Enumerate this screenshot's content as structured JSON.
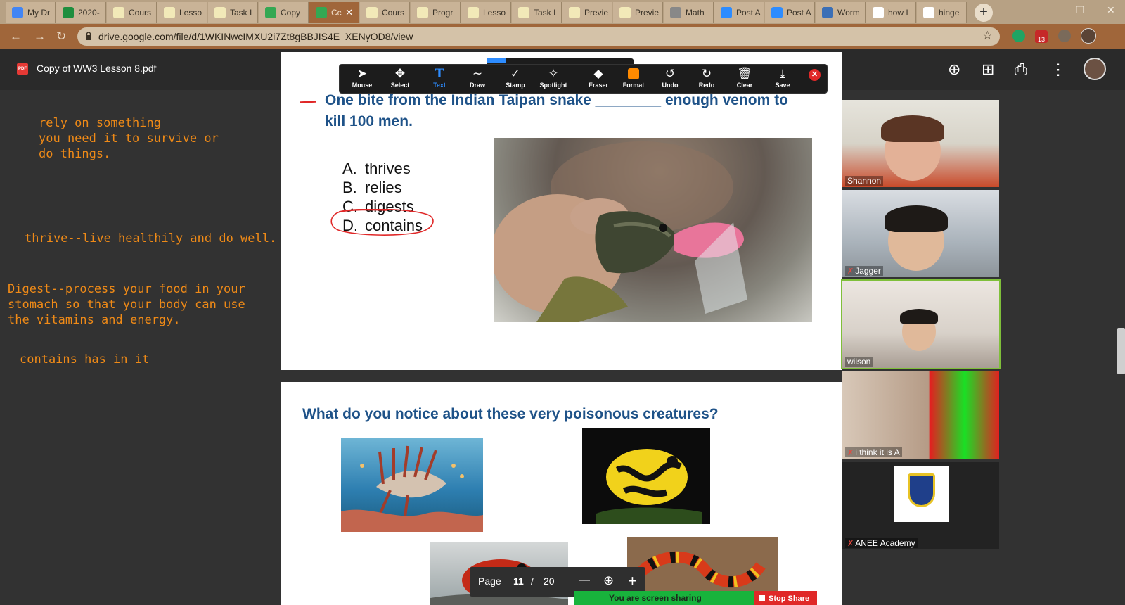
{
  "browser": {
    "tabs": [
      {
        "title": "My Dr",
        "fav": "#4285f4"
      },
      {
        "title": "2020-",
        "fav": "#1e8e3e"
      },
      {
        "title": "Cours",
        "fav": "#f2e9b8"
      },
      {
        "title": "Lesso",
        "fav": "#f2e9b8"
      },
      {
        "title": "Task I",
        "fav": "#f2e9b8"
      },
      {
        "title": "Copy",
        "fav": "#34a853"
      },
      {
        "title": "Cc",
        "fav": "#34a853",
        "active": true
      },
      {
        "title": "Cours",
        "fav": "#f2e9b8"
      },
      {
        "title": "Progr",
        "fav": "#f2e9b8"
      },
      {
        "title": "Lesso",
        "fav": "#f2e9b8"
      },
      {
        "title": "Task I",
        "fav": "#f2e9b8"
      },
      {
        "title": "Previe",
        "fav": "#f2e9b8"
      },
      {
        "title": "Previe",
        "fav": "#f2e9b8"
      },
      {
        "title": "Math",
        "fav": "#888888"
      },
      {
        "title": "Post A",
        "fav": "#2d8cff"
      },
      {
        "title": "Post A",
        "fav": "#2d8cff"
      },
      {
        "title": "Worm",
        "fav": "#3b6fb6"
      },
      {
        "title": "how I",
        "fav": "#ffffff"
      },
      {
        "title": "hinge",
        "fav": "#ffffff"
      }
    ],
    "tab_close_glyph": "✕",
    "new_tab_glyph": "+",
    "window_controls": {
      "minimize": "—",
      "restore": "❐",
      "close": "✕"
    },
    "nav": {
      "back": "←",
      "forward": "→",
      "reload": "↻"
    },
    "url": "drive.google.com/file/d/1WKINwcIMXU2i7Zt8gBBJIS4E_XENyOD8/view",
    "bookmark_glyph": "☆",
    "extension_badge": "13"
  },
  "drive": {
    "badge": "PDF",
    "title": "Copy of WW3 Lesson 8.pdf",
    "icons": {
      "add_to_drive": "⊕",
      "comment": "⊞",
      "print": "⎙",
      "more": "⋮"
    }
  },
  "notes": {
    "rely": "rely on something\nyou need it to survive or\ndo things.",
    "thrive": "thrive--live healthily and do well.",
    "digest": "Digest--process your food in your\nstomach so that your body can use\nthe vitamins and energy.",
    "contains": "contains has in it"
  },
  "slide1": {
    "question": "One bite from the Indian Taipan snake ________ enough venom to kill 100 men.",
    "options": [
      {
        "letter": "A.",
        "text": "thrives"
      },
      {
        "letter": "B.",
        "text": "relies"
      },
      {
        "letter": "C.",
        "text": "digests"
      },
      {
        "letter": "D.",
        "text": "contains"
      }
    ]
  },
  "slide2": {
    "question": "What do you notice about these very poisonous creatures?"
  },
  "annotate": {
    "tools": [
      {
        "key": "mouse",
        "label": "Mouse",
        "glyph": "➤"
      },
      {
        "key": "select",
        "label": "Select",
        "glyph": "✥"
      },
      {
        "key": "text",
        "label": "Text",
        "glyph": "T",
        "active": true
      },
      {
        "key": "draw",
        "label": "Draw",
        "glyph": "∼"
      },
      {
        "key": "stamp",
        "label": "Stamp",
        "glyph": "✓"
      },
      {
        "key": "spotlight",
        "label": "Spotlight",
        "glyph": "✧"
      },
      {
        "key": "eraser",
        "label": "Eraser",
        "glyph": "◆"
      },
      {
        "key": "format",
        "label": "Format",
        "glyph": ""
      },
      {
        "key": "undo",
        "label": "Undo",
        "glyph": "↺"
      },
      {
        "key": "redo",
        "label": "Redo",
        "glyph": "↻"
      },
      {
        "key": "clear",
        "label": "Clear",
        "glyph": "🗑"
      },
      {
        "key": "save",
        "label": "Save",
        "glyph": "⤓"
      }
    ],
    "close_glyph": "✕"
  },
  "participants": [
    {
      "name": "Shannon",
      "muted": false
    },
    {
      "name": "Jagger",
      "muted": true
    },
    {
      "name": "wilson",
      "muted": false
    },
    {
      "name": "i think it is A",
      "muted": true
    },
    {
      "name": "ANEE Academy",
      "muted": true
    }
  ],
  "mute_glyph": "✗",
  "pager": {
    "label": "Page",
    "current": "11",
    "sep": "/",
    "total": "20",
    "zoom_out": "—",
    "zoom_in": "+",
    "zoom_glyph": "⊕"
  },
  "share": {
    "status": "You are screen sharing",
    "stop": "Stop Share"
  },
  "colors": {
    "accent": "#2d8cff",
    "note": "#ef8a17",
    "slide_title": "#1e5288",
    "stop": "#e02828",
    "sharing": "#18b33c"
  }
}
